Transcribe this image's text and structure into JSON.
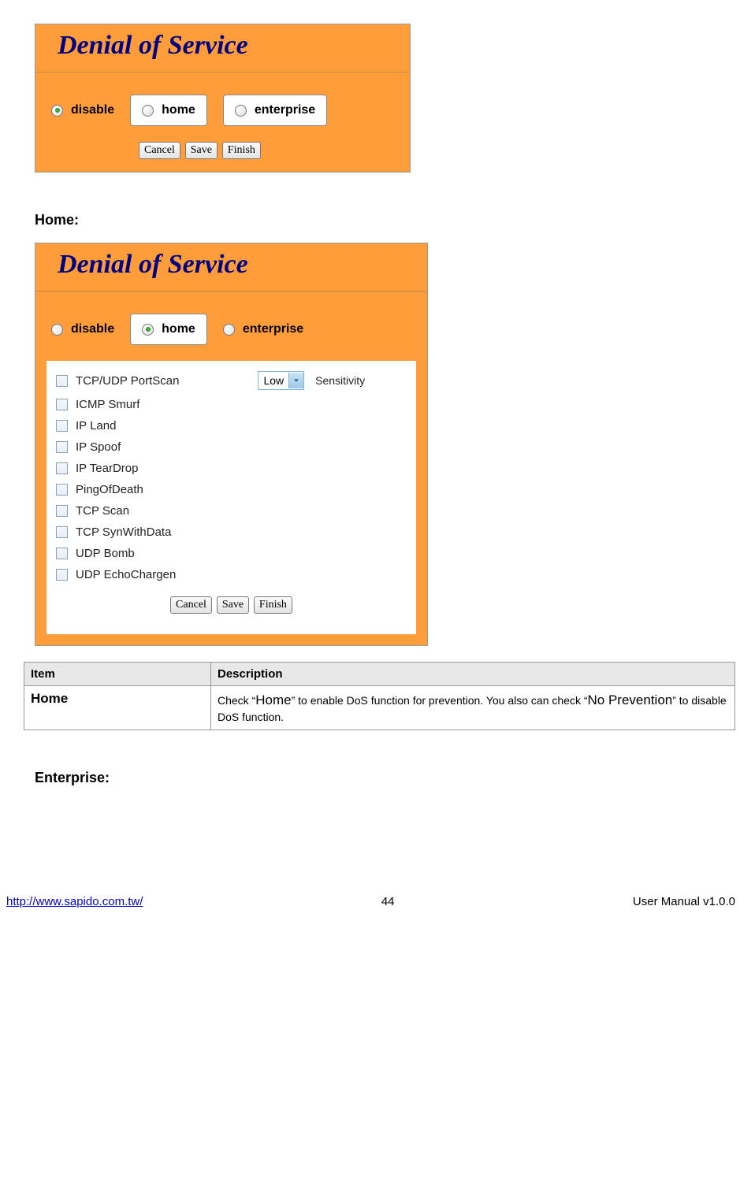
{
  "panel1": {
    "title": "Denial of Service",
    "options": {
      "disable": "disable",
      "home": "home",
      "enterprise": "enterprise"
    },
    "selected": "disable",
    "buttons": {
      "cancel": "Cancel",
      "save": "Save",
      "finish": "Finish"
    }
  },
  "heading_home": "Home:",
  "panel2": {
    "title": "Denial of Service",
    "options": {
      "disable": "disable",
      "home": "home",
      "enterprise": "enterprise"
    },
    "selected": "home",
    "sensitivity": {
      "value": "Low",
      "label": "Sensitivity"
    },
    "checks": [
      "TCP/UDP PortScan",
      "ICMP Smurf",
      "IP Land",
      "IP Spoof",
      "IP TearDrop",
      "PingOfDeath",
      "TCP Scan",
      "TCP SynWithData",
      "UDP Bomb",
      "UDP EchoChargen"
    ],
    "buttons": {
      "cancel": "Cancel",
      "save": "Save",
      "finish": "Finish"
    }
  },
  "table": {
    "header_item": "Item",
    "header_desc": "Description",
    "rows": [
      {
        "item": "Home",
        "desc_p1": "Check “",
        "desc_b1": "Home",
        "desc_p2": "” to enable DoS function for prevention. You also can check “",
        "desc_b2": "No Prevention",
        "desc_p3": "” to disable DoS function."
      }
    ]
  },
  "heading_enterprise": "Enterprise:",
  "footer": {
    "url": "http://www.sapido.com.tw/",
    "page": "44",
    "manual": "User  Manual  v1.0.0"
  }
}
